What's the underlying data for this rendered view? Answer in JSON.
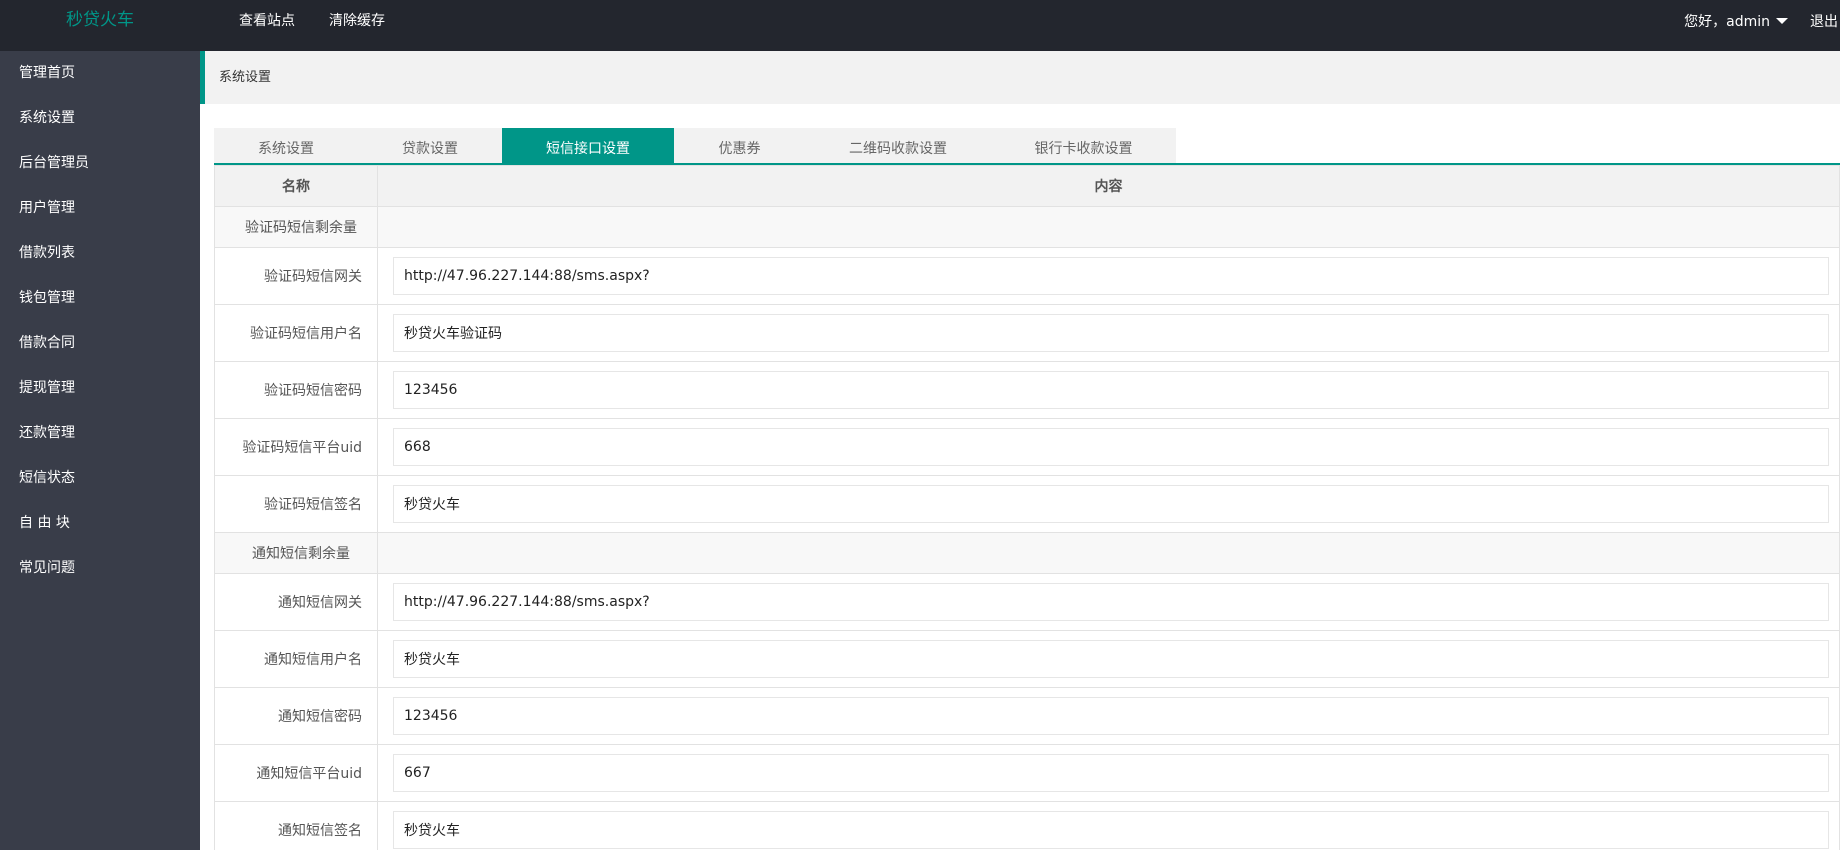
{
  "app": {
    "logo": "秒贷火车"
  },
  "topnav": {
    "view_site": "查看站点",
    "clear_cache": "清除缓存"
  },
  "user": {
    "greeting": "您好，admin",
    "logout": "退出"
  },
  "sidebar": {
    "items": [
      {
        "label": "管理首页"
      },
      {
        "label": "系统设置"
      },
      {
        "label": "后台管理员"
      },
      {
        "label": "用户管理"
      },
      {
        "label": "借款列表"
      },
      {
        "label": "钱包管理"
      },
      {
        "label": "借款合同"
      },
      {
        "label": "提现管理"
      },
      {
        "label": "还款管理"
      },
      {
        "label": "短信状态"
      },
      {
        "label": "自 由 块"
      },
      {
        "label": "常见问题"
      }
    ]
  },
  "breadcrumb": "系统设置",
  "tabs": [
    {
      "label": "系统设置"
    },
    {
      "label": "贷款设置"
    },
    {
      "label": "短信接口设置"
    },
    {
      "label": "优惠券"
    },
    {
      "label": "二维码收款设置"
    },
    {
      "label": "银行卡收款设置"
    }
  ],
  "active_tab_index": 2,
  "table": {
    "headers": {
      "name": "名称",
      "content": "内容"
    },
    "rows": [
      {
        "type": "section",
        "label": "验证码短信剩余量",
        "value": ""
      },
      {
        "type": "field",
        "label": "验证码短信网关",
        "value": "http://47.96.227.144:88/sms.aspx?"
      },
      {
        "type": "field",
        "label": "验证码短信用户名",
        "value": "秒贷火车验证码"
      },
      {
        "type": "field",
        "label": "验证码短信密码",
        "value": "123456"
      },
      {
        "type": "field",
        "label": "验证码短信平台uid",
        "value": "668"
      },
      {
        "type": "field",
        "label": "验证码短信签名",
        "value": "秒贷火车"
      },
      {
        "type": "section",
        "label": "通知短信剩余量",
        "value": ""
      },
      {
        "type": "field",
        "label": "通知短信网关",
        "value": "http://47.96.227.144:88/sms.aspx?"
      },
      {
        "type": "field",
        "label": "通知短信用户名",
        "value": "秒贷火车"
      },
      {
        "type": "field",
        "label": "通知短信密码",
        "value": "123456"
      },
      {
        "type": "field",
        "label": "通知短信平台uid",
        "value": "667"
      },
      {
        "type": "field",
        "label": "通知短信签名",
        "value": "秒贷火车"
      }
    ]
  },
  "colors": {
    "accent": "#009688",
    "header_bg": "#23262e",
    "sidebar_bg": "#393d49"
  }
}
